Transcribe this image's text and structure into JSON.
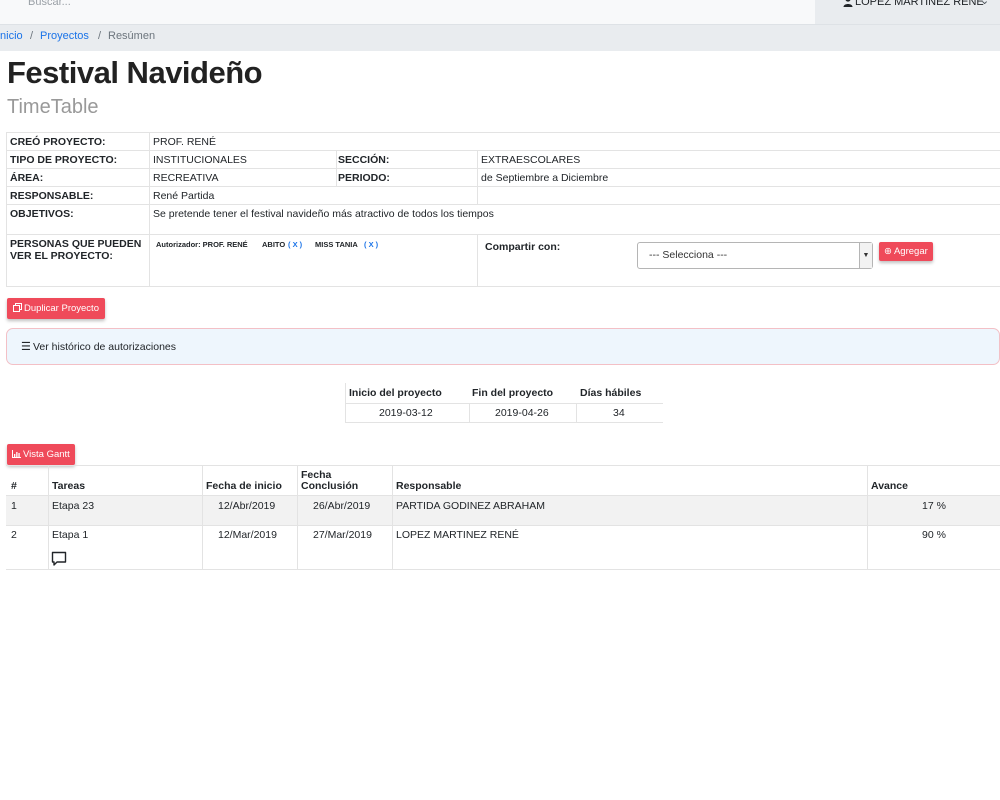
{
  "topbar": {
    "search_placeholder": "Buscar...",
    "user_name": "LOPEZ MARTINEZ RENÉ"
  },
  "breadcrumb": {
    "home": "Inicio",
    "projects": "Proyectos",
    "current": "Resúmen",
    "separator": "/"
  },
  "page": {
    "title": "Festival Navideño",
    "subtitle": "TimeTable"
  },
  "info": {
    "creo_label": "CREÓ PROYECTO:",
    "creo_value": "PROF. RENÉ",
    "tipo_label": "TIPO DE PROYECTO:",
    "tipo_value": "INSTITUCIONALES",
    "seccion_label": "SECCIÓN:",
    "seccion_value": "EXTRAESCOLARES",
    "area_label": "ÁREA:",
    "area_value": "RECREATIVA",
    "periodo_label": "PERIODO:",
    "periodo_value": "de Septiembre a Diciembre",
    "resp_label": "RESPONSABLE:",
    "resp_value": "René Partida",
    "obj_label": "OBJETIVOS:",
    "obj_value": "Se pretende tener el festival navideño más atractivo de todos los tiempos",
    "personas_label_1": "PERSONAS QUE PUEDEN",
    "personas_label_2": "VER EL PROYECTO:",
    "authorizer": "Autorizador: PROF. RENÉ",
    "viewers": [
      {
        "name": "ABITO",
        "remove": "( X )"
      },
      {
        "name": "MISS TANIA",
        "remove": "( X )"
      }
    ],
    "share_label": "Compartir con:",
    "share_select": "--- Selecciona ---",
    "add_button": "Agregar"
  },
  "buttons": {
    "duplicate": "Duplicar Proyecto",
    "gantt": "Vista Gantt"
  },
  "history": {
    "label": "Ver histórico de autorizaciones"
  },
  "summary": {
    "headers": [
      "Inicio del proyecto",
      "Fin del proyecto",
      "Días hábiles"
    ],
    "values": [
      "2019-03-12",
      "2019-04-26",
      "34"
    ]
  },
  "tasks": {
    "headers": {
      "num": "#",
      "task": "Tareas",
      "start": "Fecha de inicio",
      "end_1": "Fecha",
      "end_2": "Conclusión",
      "owner": "Responsable",
      "progress": "Avance"
    },
    "rows": [
      {
        "num": "1",
        "task": "Etapa 23",
        "start": "12/Abr/2019",
        "end": "26/Abr/2019",
        "owner": "PARTIDA GODINEZ ABRAHAM",
        "progress": "17 %"
      },
      {
        "num": "2",
        "task": "Etapa 1",
        "start": "12/Mar/2019",
        "end": "27/Mar/2019",
        "owner": "LOPEZ MARTINEZ RENÉ",
        "progress": "90 %"
      }
    ]
  },
  "colors": {
    "accent_red": "#ef4a5a",
    "link_blue": "#1a73e8",
    "history_bg": "#eef6fd"
  }
}
